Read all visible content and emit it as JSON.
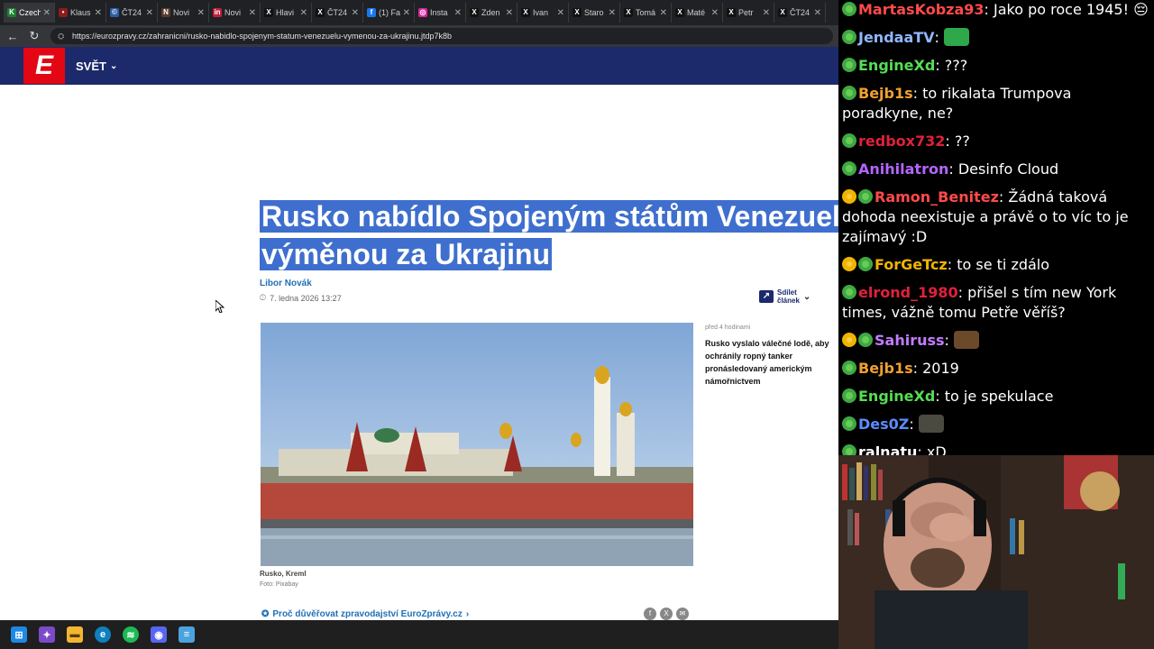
{
  "browser": {
    "tabs": [
      {
        "label": "Czech",
        "fav_color": "#1a7f2f",
        "fav_char": "K"
      },
      {
        "label": "Klaus",
        "fav_color": "#8b1c1c",
        "fav_char": "•"
      },
      {
        "label": "ČT24",
        "fav_color": "#2a5da8",
        "fav_char": "©"
      },
      {
        "label": "Novi",
        "fav_color": "#5a3b2a",
        "fav_char": "N"
      },
      {
        "label": "Novi",
        "fav_color": "#c41e3a",
        "fav_char": "in"
      },
      {
        "label": "Hlavi",
        "fav_color": "#111111",
        "fav_char": "X"
      },
      {
        "label": "ČT24",
        "fav_color": "#111111",
        "fav_char": "X"
      },
      {
        "label": "(1) Fa",
        "fav_color": "#1877f2",
        "fav_char": "f"
      },
      {
        "label": "Insta",
        "fav_color": "#d6249f",
        "fav_char": "◎"
      },
      {
        "label": "Zden",
        "fav_color": "#111111",
        "fav_char": "X"
      },
      {
        "label": "Ivan",
        "fav_color": "#111111",
        "fav_char": "X"
      },
      {
        "label": "Staro",
        "fav_color": "#111111",
        "fav_char": "X"
      },
      {
        "label": "Tomá",
        "fav_color": "#111111",
        "fav_char": "X"
      },
      {
        "label": "Maté",
        "fav_color": "#111111",
        "fav_char": "X"
      },
      {
        "label": "Petr",
        "fav_color": "#111111",
        "fav_char": "X"
      },
      {
        "label": "ČT24",
        "fav_color": "#111111",
        "fav_char": "X"
      }
    ],
    "url": "https://eurozpravy.cz/zahranicni/rusko-nabidlo-spojenym-statum-venezuelu-vymenou-za-ukrajinu.jtdp7k8b"
  },
  "site": {
    "logo_char": "E",
    "section": "SVĚT",
    "brand_color": "#1c2a6b",
    "accent_color": "#e30613"
  },
  "article": {
    "headline_line1": "Rusko nabídlo Spojeným státům Venezuelu",
    "headline_line2": "výměnou za Ukrajinu",
    "author": "Libor Novák",
    "date": "7. ledna 2026 13:27",
    "share_line1": "Sdílet",
    "share_line2": "článek",
    "photo_caption": "Rusko, Kreml",
    "photo_credit": "Foto: Pixabay",
    "trust_link": "Proč důvěřovat zpravodajství EuroZprávy.cz",
    "related_time": "před 4 hodinami",
    "related_title": "Rusko vyslalo válečné lodě, aby ochránily ropný tanker pronásledovaný americkým námořnictvem"
  },
  "chat": [
    {
      "user": "MartasKobza93",
      "color": "#ff4a4a",
      "gold": false,
      "text": "Jako po roce 1945! 😔"
    },
    {
      "user": "JendaaTV",
      "color": "#8fb8ff",
      "gold": false,
      "text": "",
      "emote": "#2ea84a"
    },
    {
      "user": "EngineXd",
      "color": "#55dd55",
      "gold": false,
      "text": "???"
    },
    {
      "user": "Bejb1s",
      "color": "#f0a030",
      "gold": false,
      "text": "to rikalata Trumpova poradkyne, ne?"
    },
    {
      "user": "redbox732",
      "color": "#e0213b",
      "gold": false,
      "text": "??"
    },
    {
      "user": "Anihilatron",
      "color": "#b366ff",
      "gold": false,
      "text": "Desinfo Cloud"
    },
    {
      "user": "Ramon_Benitez",
      "color": "#ff4a4a",
      "gold": true,
      "text": "Žádná taková dohoda neexistuje a právě o to víc to je zajímavý :D"
    },
    {
      "user": "ForGeTcz",
      "color": "#f0b400",
      "gold": true,
      "text": "to se ti zdálo"
    },
    {
      "user": "elrond_1980",
      "color": "#e0213b",
      "gold": false,
      "text": "přišel s tím new York times, vážně tomu Petře věříš?"
    },
    {
      "user": "Sahiruss",
      "color": "#c27cff",
      "gold": true,
      "text": "",
      "emote": "#6b4a2a"
    },
    {
      "user": "Bejb1s",
      "color": "#f0a030",
      "gold": false,
      "text": "2019"
    },
    {
      "user": "EngineXd",
      "color": "#55dd55",
      "gold": false,
      "text": "to je spekulace"
    },
    {
      "user": "Des0Z",
      "color": "#5b8cff",
      "gold": false,
      "text": "",
      "emote": "#4a4a40"
    },
    {
      "user": "ralnatu",
      "color": "#ffffff",
      "gold": false,
      "text": "xD"
    }
  ]
}
